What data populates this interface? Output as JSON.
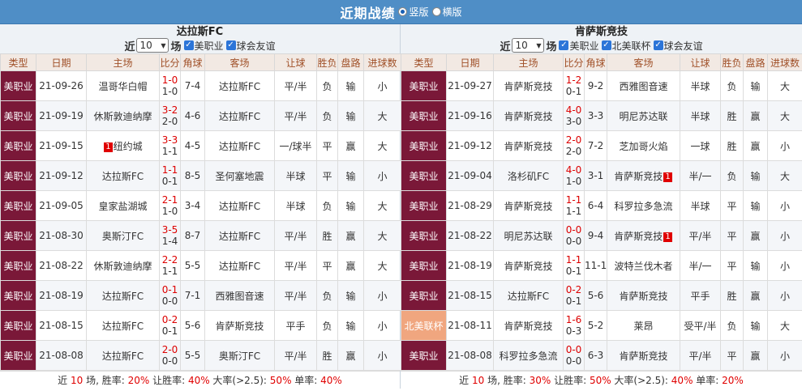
{
  "header": {
    "title": "近期战绩",
    "options": [
      "竖版",
      "横版"
    ],
    "selected_option": "竖版"
  },
  "panels": [
    {
      "team": "达拉斯FC",
      "filter": {
        "prefix": "近",
        "count": "10",
        "suffix": "场",
        "checkboxes": [
          "美职业",
          "球会友谊"
        ]
      },
      "columns": [
        "类型",
        "日期",
        "主场",
        "比分",
        "角球",
        "客场",
        "让球",
        "胜负",
        "盘路",
        "进球数"
      ],
      "rows": [
        {
          "type": "美职业",
          "date": "21-09-26",
          "home": "温哥华白帽",
          "home_green": false,
          "home_badge": "",
          "ft": "1-0",
          "ht": "1-0",
          "corner": "7-4",
          "away": "达拉斯FC",
          "away_green": true,
          "away_badge": "",
          "handicap": "平/半",
          "result": "负",
          "result_color": "blue",
          "pan": "输",
          "pan_color": "blue",
          "goals": "小",
          "goals_color": "blue"
        },
        {
          "type": "美职业",
          "date": "21-09-19",
          "home": "休斯敦迪纳摩",
          "home_green": false,
          "home_badge": "",
          "ft": "3-2",
          "ht": "2-0",
          "corner": "4-6",
          "away": "达拉斯FC",
          "away_green": true,
          "away_badge": "",
          "handicap": "平/半",
          "result": "负",
          "result_color": "blue",
          "pan": "输",
          "pan_color": "blue",
          "goals": "大",
          "goals_color": "red"
        },
        {
          "type": "美职业",
          "date": "21-09-15",
          "home": "纽约城",
          "home_green": false,
          "home_badge": "1",
          "ft": "3-3",
          "ht": "1-1",
          "corner": "4-5",
          "away": "达拉斯FC",
          "away_green": true,
          "away_badge": "",
          "handicap": "一/球半",
          "result": "平",
          "result_color": "green",
          "pan": "赢",
          "pan_color": "red",
          "goals": "大",
          "goals_color": "red"
        },
        {
          "type": "美职业",
          "date": "21-09-12",
          "home": "达拉斯FC",
          "home_green": true,
          "home_badge": "",
          "ft": "1-1",
          "ht": "0-1",
          "corner": "8-5",
          "away": "圣何塞地震",
          "away_green": false,
          "away_badge": "",
          "handicap": "半球",
          "result": "平",
          "result_color": "green",
          "pan": "输",
          "pan_color": "blue",
          "goals": "小",
          "goals_color": "blue"
        },
        {
          "type": "美职业",
          "date": "21-09-05",
          "home": "皇家盐湖城",
          "home_green": false,
          "home_badge": "",
          "ft": "2-1",
          "ht": "1-0",
          "corner": "3-4",
          "away": "达拉斯FC",
          "away_green": true,
          "away_badge": "",
          "handicap": "半球",
          "result": "负",
          "result_color": "blue",
          "pan": "输",
          "pan_color": "blue",
          "goals": "大",
          "goals_color": "red"
        },
        {
          "type": "美职业",
          "date": "21-08-30",
          "home": "奥斯汀FC",
          "home_green": false,
          "home_badge": "",
          "ft": "3-5",
          "ht": "1-4",
          "corner": "8-7",
          "away": "达拉斯FC",
          "away_green": true,
          "away_badge": "",
          "handicap": "平/半",
          "result": "胜",
          "result_color": "red",
          "pan": "赢",
          "pan_color": "red",
          "goals": "大",
          "goals_color": "red"
        },
        {
          "type": "美职业",
          "date": "21-08-22",
          "home": "休斯敦迪纳摩",
          "home_green": false,
          "home_badge": "",
          "ft": "2-2",
          "ht": "1-1",
          "corner": "5-5",
          "away": "达拉斯FC",
          "away_green": true,
          "away_badge": "",
          "handicap": "平/半",
          "result": "平",
          "result_color": "green",
          "pan": "赢",
          "pan_color": "red",
          "goals": "大",
          "goals_color": "red"
        },
        {
          "type": "美职业",
          "date": "21-08-19",
          "home": "达拉斯FC",
          "home_green": true,
          "home_badge": "",
          "ft": "0-1",
          "ht": "0-0",
          "corner": "7-1",
          "away": "西雅图音速",
          "away_green": false,
          "away_badge": "",
          "handicap": "平/半",
          "result": "负",
          "result_color": "blue",
          "pan": "输",
          "pan_color": "blue",
          "goals": "小",
          "goals_color": "blue"
        },
        {
          "type": "美职业",
          "date": "21-08-15",
          "home": "达拉斯FC",
          "home_green": true,
          "home_badge": "",
          "ft": "0-2",
          "ht": "0-1",
          "corner": "5-6",
          "away": "肯萨斯竞技",
          "away_green": false,
          "away_badge": "",
          "handicap": "平手",
          "result": "负",
          "result_color": "blue",
          "pan": "输",
          "pan_color": "blue",
          "goals": "小",
          "goals_color": "blue"
        },
        {
          "type": "美职业",
          "date": "21-08-08",
          "home": "达拉斯FC",
          "home_green": true,
          "home_badge": "",
          "ft": "2-0",
          "ht": "0-0",
          "corner": "5-5",
          "away": "奥斯汀FC",
          "away_green": false,
          "away_badge": "",
          "handicap": "平/半",
          "result": "胜",
          "result_color": "red",
          "pan": "赢",
          "pan_color": "red",
          "goals": "小",
          "goals_color": "blue"
        }
      ],
      "summary": {
        "recent": "近 ",
        "recent_num": "10",
        "p1": " 场, 胜率: ",
        "win": "20%",
        "p2": " 让胜率: ",
        "hwin": "40%",
        "p3": " 大率(>2.5): ",
        "big": "50%",
        "p4": " 单率: ",
        "odd": "40%"
      }
    },
    {
      "team": "肯萨斯竞技",
      "filter": {
        "prefix": "近",
        "count": "10",
        "suffix": "场",
        "checkboxes": [
          "美职业",
          "北美联杯",
          "球会友谊"
        ]
      },
      "columns": [
        "类型",
        "日期",
        "主场",
        "比分",
        "角球",
        "客场",
        "让球",
        "胜负",
        "盘路",
        "进球数"
      ],
      "rows": [
        {
          "type": "美职业",
          "cup": false,
          "date": "21-09-27",
          "home": "肯萨斯竞技",
          "home_green": true,
          "home_badge": "",
          "ft": "1-2",
          "ht": "0-1",
          "corner": "9-2",
          "away": "西雅图音速",
          "away_green": false,
          "away_badge": "",
          "handicap": "半球",
          "result": "负",
          "result_color": "blue",
          "pan": "输",
          "pan_color": "blue",
          "goals": "大",
          "goals_color": "red"
        },
        {
          "type": "美职业",
          "cup": false,
          "date": "21-09-16",
          "home": "肯萨斯竞技",
          "home_green": true,
          "home_badge": "",
          "ft": "4-0",
          "ht": "3-0",
          "corner": "3-3",
          "away": "明尼苏达联",
          "away_green": false,
          "away_badge": "",
          "handicap": "半球",
          "result": "胜",
          "result_color": "red",
          "pan": "赢",
          "pan_color": "red",
          "goals": "大",
          "goals_color": "red"
        },
        {
          "type": "美职业",
          "cup": false,
          "date": "21-09-12",
          "home": "肯萨斯竞技",
          "home_green": true,
          "home_badge": "",
          "ft": "2-0",
          "ht": "2-0",
          "corner": "7-2",
          "away": "芝加哥火焰",
          "away_green": false,
          "away_badge": "",
          "handicap": "一球",
          "result": "胜",
          "result_color": "red",
          "pan": "赢",
          "pan_color": "red",
          "goals": "小",
          "goals_color": "blue"
        },
        {
          "type": "美职业",
          "cup": false,
          "date": "21-09-04",
          "home": "洛杉矶FC",
          "home_green": false,
          "home_badge": "",
          "ft": "4-0",
          "ht": "1-0",
          "corner": "3-1",
          "away": "肯萨斯竞技",
          "away_green": true,
          "away_badge": "1",
          "handicap": "半/一",
          "result": "负",
          "result_color": "blue",
          "pan": "输",
          "pan_color": "blue",
          "goals": "大",
          "goals_color": "red"
        },
        {
          "type": "美职业",
          "cup": false,
          "date": "21-08-29",
          "home": "肯萨斯竞技",
          "home_green": true,
          "home_badge": "",
          "ft": "1-1",
          "ht": "1-1",
          "corner": "6-4",
          "away": "科罗拉多急流",
          "away_green": false,
          "away_badge": "",
          "handicap": "半球",
          "result": "平",
          "result_color": "green",
          "pan": "输",
          "pan_color": "blue",
          "goals": "小",
          "goals_color": "blue"
        },
        {
          "type": "美职业",
          "cup": false,
          "date": "21-08-22",
          "home": "明尼苏达联",
          "home_green": false,
          "home_badge": "",
          "ft": "0-0",
          "ht": "0-0",
          "corner": "9-4",
          "away": "肯萨斯竞技",
          "away_green": true,
          "away_badge": "1",
          "handicap": "平/半",
          "result": "平",
          "result_color": "green",
          "pan": "赢",
          "pan_color": "red",
          "goals": "小",
          "goals_color": "blue"
        },
        {
          "type": "美职业",
          "cup": false,
          "date": "21-08-19",
          "home": "肯萨斯竞技",
          "home_green": true,
          "home_badge": "",
          "ft": "1-1",
          "ht": "0-1",
          "corner": "11-1",
          "away": "波特兰伐木者",
          "away_green": false,
          "away_badge": "",
          "handicap": "半/一",
          "result": "平",
          "result_color": "green",
          "pan": "输",
          "pan_color": "blue",
          "goals": "小",
          "goals_color": "blue"
        },
        {
          "type": "美职业",
          "cup": false,
          "date": "21-08-15",
          "home": "达拉斯FC",
          "home_green": false,
          "home_badge": "",
          "ft": "0-2",
          "ht": "0-1",
          "corner": "5-6",
          "away": "肯萨斯竞技",
          "away_green": true,
          "away_badge": "",
          "handicap": "平手",
          "result": "胜",
          "result_color": "red",
          "pan": "赢",
          "pan_color": "red",
          "goals": "小",
          "goals_color": "blue"
        },
        {
          "type": "北美联杯",
          "cup": true,
          "date": "21-08-11",
          "home": "肯萨斯竞技",
          "home_green": true,
          "home_badge": "",
          "ft": "1-6",
          "ht": "0-3",
          "corner": "5-2",
          "away": "莱昂",
          "away_green": false,
          "away_badge": "",
          "handicap": "受平/半",
          "result": "负",
          "result_color": "blue",
          "pan": "输",
          "pan_color": "blue",
          "goals": "大",
          "goals_color": "red"
        },
        {
          "type": "美职业",
          "cup": false,
          "date": "21-08-08",
          "home": "科罗拉多急流",
          "home_green": false,
          "home_badge": "",
          "ft": "0-0",
          "ht": "0-0",
          "corner": "6-3",
          "away": "肯萨斯竞技",
          "away_green": true,
          "away_badge": "",
          "handicap": "平/半",
          "result": "平",
          "result_color": "green",
          "pan": "赢",
          "pan_color": "red",
          "goals": "小",
          "goals_color": "blue"
        }
      ],
      "summary": {
        "recent": "近 ",
        "recent_num": "10",
        "p1": " 场, 胜率: ",
        "win": "30%",
        "p2": " 让胜率: ",
        "hwin": "50%",
        "p3": " 大率(>2.5): ",
        "big": "40%",
        "p4": " 单率: ",
        "odd": "20%"
      }
    }
  ]
}
